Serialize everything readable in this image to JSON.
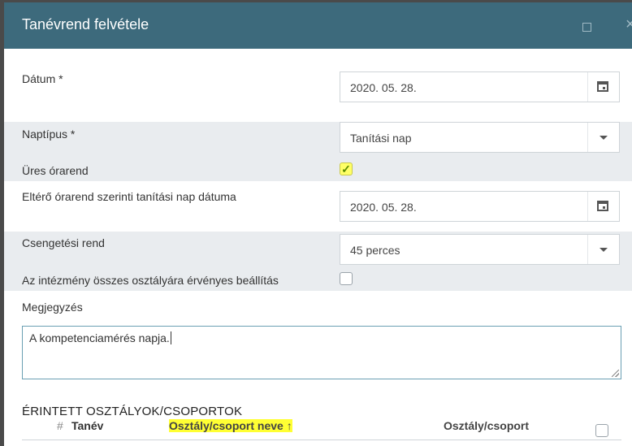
{
  "dialog": {
    "title": "Tanévrend felvétele",
    "icons": {
      "maximize": "maximize-icon",
      "close": "close-icon"
    }
  },
  "form": {
    "datum": {
      "label": "Dátum *",
      "value": "2020. 05. 28.",
      "icon": "calendar-icon"
    },
    "naptipus": {
      "label": "Naptípus *",
      "value": "Tanítási nap",
      "icon": "chevron-down-icon"
    },
    "ures_orarend": {
      "label": "Üres órarend",
      "checked": true,
      "mark": "✓"
    },
    "eltero_datum": {
      "label": "Eltérő órarend szerinti tanítási nap dátuma",
      "value": "2020. 05. 28.",
      "icon": "calendar-icon"
    },
    "csengetesi_rend": {
      "label": "Csengetési rend",
      "value": "45 perces",
      "icon": "chevron-down-icon"
    },
    "osszes_osztaly": {
      "label": "Az intézmény összes osztályára érvényes beállítás",
      "checked": false
    },
    "megjegyzes": {
      "label": "Megjegyzés",
      "value": "A kompetenciamérés napja."
    }
  },
  "affected": {
    "title": "ÉRINTETT OSZTÁLYOK/CSOPORTOK",
    "columns": {
      "index": "#",
      "tanev": "Tanév",
      "name": "Osztály/csoport neve",
      "name_sort": "↑",
      "type": "Osztály/csoport"
    }
  },
  "colors": {
    "titlebar": "#3d6a7c",
    "highlight": "#ffff33",
    "row_shade": "#e9ecef"
  }
}
